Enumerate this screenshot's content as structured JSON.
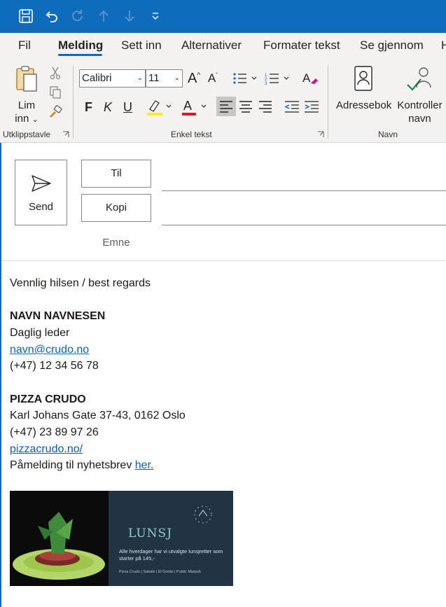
{
  "tabs": [
    "Fil",
    "Melding",
    "Sett inn",
    "Alternativer",
    "Formater tekst",
    "Se gjennom",
    "H"
  ],
  "ribbon": {
    "paste_line1": "Lim",
    "paste_line2": "inn",
    "font_name": "Calibri",
    "font_size": "11",
    "bold": "F",
    "italic": "K",
    "underline": "U",
    "highlight_color": "#fff100",
    "font_color": "#e81123",
    "address_book": "Adressebok",
    "check_names_line1": "Kontroller",
    "check_names_line2": "navn",
    "group_clipboard": "Utklippstavle",
    "group_basic_text": "Enkel tekst",
    "group_names": "Navn"
  },
  "compose": {
    "send": "Send",
    "to": "Til",
    "cc": "Kopi",
    "subject": "Emne"
  },
  "signature": {
    "greeting": "Vennlig hilsen / best regards",
    "name": "NAVN NAVNESEN",
    "role": "Daglig leder",
    "email": "navn@crudo.no",
    "phone": "(+47) 12 34 56 78",
    "company": "PIZZA CRUDO",
    "address": "Karl Johans Gate 37-43, 0162 Oslo",
    "company_phone": "(+47) 23 89 97 26",
    "website": "pizzacrudo.no/",
    "newsletter_text": "Påmelding til nyhetsbrev ",
    "newsletter_link": "her."
  },
  "banner": {
    "title": "LUNSJ",
    "text": "Alle hverdager har vi utvalgte lunsjretter som starter på 145,-",
    "footer": "Pizza Crudo | Sabaki | El Gordo | Public Matpub"
  },
  "colors": {
    "accent": "#0f6cbd",
    "link": "#0563c1"
  }
}
